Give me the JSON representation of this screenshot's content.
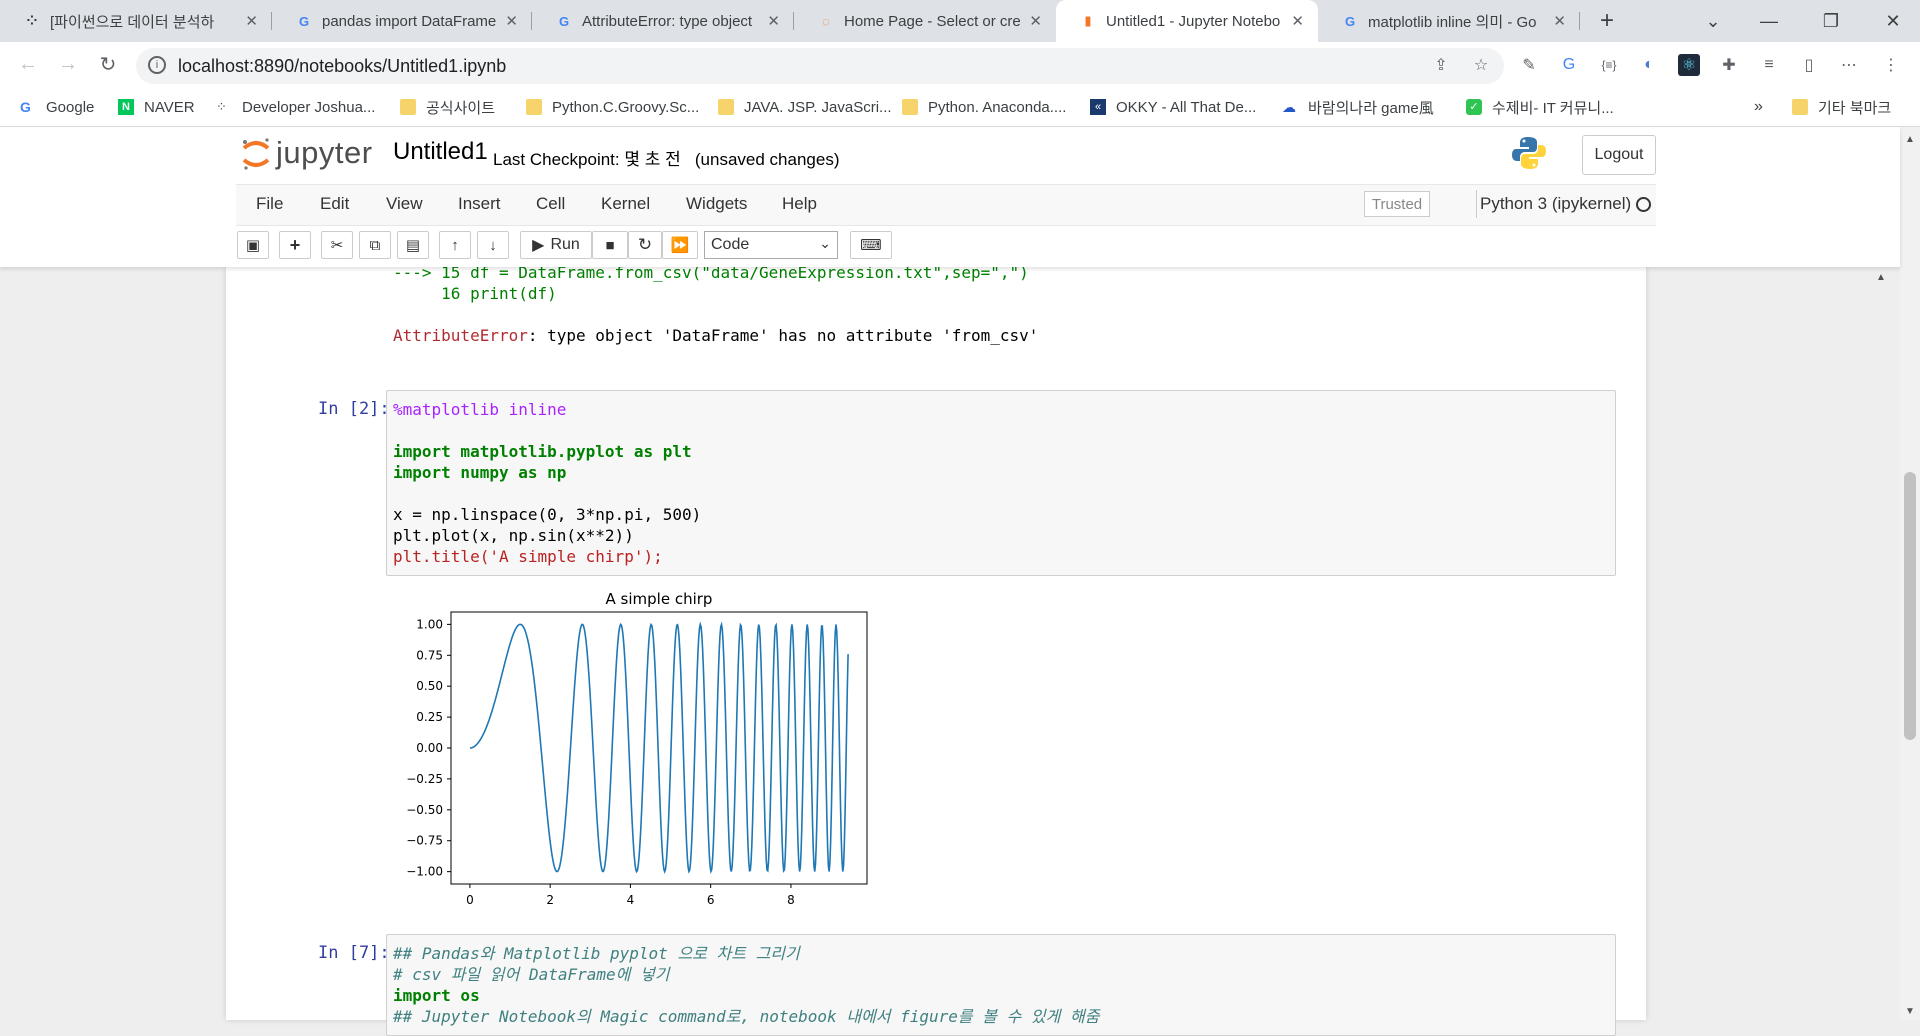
{
  "browser": {
    "tabs": [
      {
        "title": "[파이썬으로 데이터 분석하",
        "icon": "dots-favicon"
      },
      {
        "title": "pandas import DataFrame",
        "icon": "google-favicon"
      },
      {
        "title": "AttributeError: type object",
        "icon": "google-favicon"
      },
      {
        "title": "Home Page - Select or cre",
        "icon": "jupyter-favicon"
      },
      {
        "title": "Untitled1 - Jupyter Notebo",
        "icon": "notebook-favicon",
        "active": true
      },
      {
        "title": "matplotlib inline 의미 - Go",
        "icon": "google-favicon"
      }
    ],
    "url": "localhost:8890/notebooks/Untitled1.ipynb",
    "bookmarks": [
      {
        "label": "Google",
        "icon": "google-favicon"
      },
      {
        "label": "NAVER",
        "icon": "naver-favicon"
      },
      {
        "label": "Developer Joshua...",
        "icon": "dots-favicon"
      },
      {
        "label": "공식사이트",
        "icon": "folder-icon"
      },
      {
        "label": "Python.C.Groovy.Sc...",
        "icon": "folder-icon"
      },
      {
        "label": "JAVA. JSP. JavaScri...",
        "icon": "folder-icon"
      },
      {
        "label": "Python. Anaconda....",
        "icon": "folder-icon"
      },
      {
        "label": "OKKY - All That De...",
        "icon": "okky-favicon"
      },
      {
        "label": "바람의나라 game風",
        "icon": "cloud-favicon"
      },
      {
        "label": "수제비- IT 커뮤니...",
        "icon": "chat-favicon"
      }
    ],
    "bookmarks_more": "»",
    "other_bookmarks": "기타 북마크"
  },
  "jupyter": {
    "logo_text": "jupyter",
    "notebook_name": "Untitled1",
    "checkpoint": "Last Checkpoint: 몇 초 전   (unsaved changes)",
    "logout": "Logout",
    "menu": [
      "File",
      "Edit",
      "View",
      "Insert",
      "Cell",
      "Kernel",
      "Widgets",
      "Help"
    ],
    "trusted": "Trusted",
    "kernel": "Python 3 (ipykernel)",
    "run_label": "Run",
    "cell_type": "Code"
  },
  "cells": {
    "error_output": {
      "line15": "---> 15 df = DataFrame.from_csv(\"data/GeneExpression.txt\",sep=\",\")",
      "line16": "     16 print(df)",
      "error_name": "AttributeError",
      "error_msg": ": type object 'DataFrame' has no attribute 'from_csv'"
    },
    "cell2": {
      "prompt": "In [2]:",
      "magic": "%matplotlib inline",
      "import1": "import matplotlib.pyplot as plt",
      "import2": "import numpy as np",
      "line_x": "x = np.linspace(0, 3*np.pi, 500)",
      "line_plot": "plt.plot(x, np.sin(x**2))",
      "line_title": "plt.title('A simple chirp');"
    },
    "cell7": {
      "prompt": "In [7]:",
      "comment1": "## Pandas와 Matplotlib pyplot 으로 차트 그리기",
      "comment2": "# csv 파일 읽어 DataFrame에 넣기",
      "import_os": "import os",
      "comment3": "## Jupyter Notebook의 Magic command로, notebook 내에서 figure를 볼 수 있게 해줌"
    }
  },
  "chart_data": {
    "type": "line",
    "title": "A simple chirp",
    "xlabel": "",
    "ylabel": "",
    "function": "y = sin(x^2)",
    "x_range": [
      0,
      9.42477796
    ],
    "num_points": 500,
    "xlim": [
      -0.471,
      9.896
    ],
    "ylim": [
      -1.1,
      1.1
    ],
    "x_ticks": [
      0,
      2,
      4,
      6,
      8
    ],
    "y_ticks": [
      1.0,
      0.75,
      0.5,
      0.25,
      0.0,
      -0.25,
      -0.5,
      -0.75,
      -1.0
    ],
    "y_tick_labels": [
      "1.00",
      "0.75",
      "0.50",
      "0.25",
      "0.00",
      "−0.25",
      "−0.50",
      "−0.75",
      "−1.00"
    ],
    "x_tick_labels": [
      "0",
      "2",
      "4",
      "6",
      "8"
    ],
    "line_color": "#1f77b4",
    "grid": false
  },
  "colors": {
    "prompt": "#303f9f",
    "keyword": "#008000",
    "string": "#ba2121",
    "error": "#b22b31",
    "comment": "#408080",
    "magic": "#aa22ff"
  }
}
